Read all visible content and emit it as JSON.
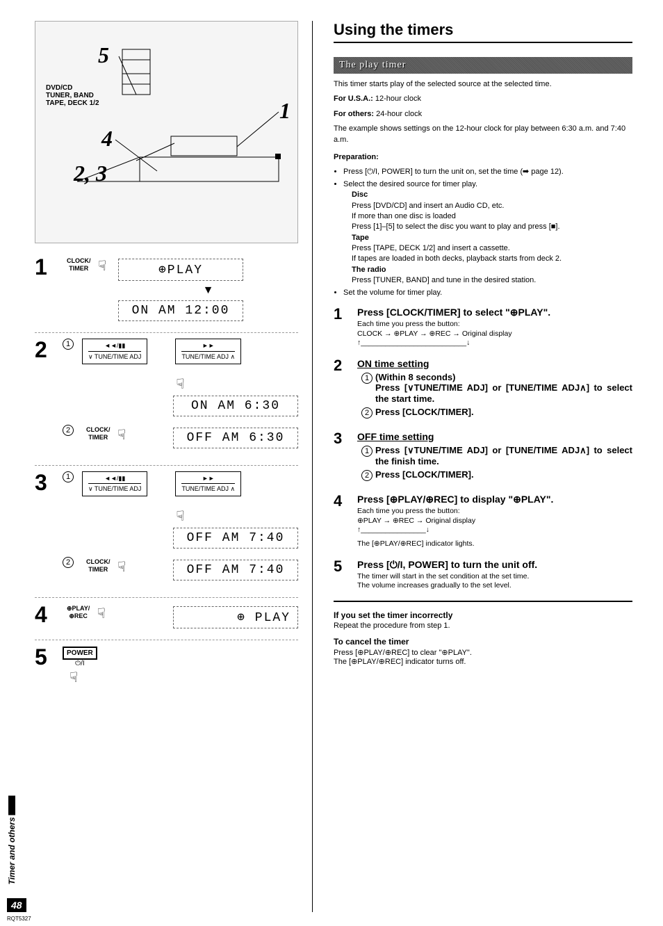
{
  "side_tab": "Timer and others",
  "page_number": "48",
  "doc_code": "RQT5327",
  "left": {
    "diag_labels": {
      "sources": "DVD/CD\nTUNER, BAND\nTAPE, DECK 1/2"
    },
    "diag_nums": {
      "n1": "1",
      "n2": "2, 3",
      "n4": "4",
      "n5": "5"
    },
    "step1": {
      "num": "1",
      "btn": "CLOCK/\nTIMER",
      "disp1": "⊕PLAY",
      "disp2": "ON   AM 12:00"
    },
    "step2": {
      "num": "2",
      "sub1": "①",
      "sub2": "②",
      "tune_left_top": "◄◄/▮▮",
      "tune_left_bot": "∨ TUNE/TIME ADJ",
      "tune_right_top": "►►",
      "tune_right_bot": "TUNE/TIME ADJ ∧",
      "btn": "CLOCK/\nTIMER",
      "disp1": "ON   AM  6:30",
      "disp2": "OFF  AM  6:30"
    },
    "step3": {
      "num": "3",
      "sub1": "①",
      "sub2": "②",
      "tune_left_top": "◄◄/▮▮",
      "tune_left_bot": "∨ TUNE/TIME ADJ",
      "tune_right_top": "►►",
      "tune_right_bot": "TUNE/TIME ADJ ∧",
      "btn": "CLOCK/\nTIMER",
      "disp1": "OFF  AM  7:40",
      "disp2": "OFF  AM  7:40"
    },
    "step4": {
      "num": "4",
      "btn": "⊕PLAY/\n⊕REC",
      "disp": "⊕ PLAY"
    },
    "step5": {
      "num": "5",
      "btn": "POWER",
      "btn_sub": "⏻/I"
    }
  },
  "right": {
    "title": "Using the timers",
    "banner": "The play timer",
    "intro": {
      "line1": "This timer starts play of the selected source at the selected time.",
      "usa_label": "For U.S.A.:",
      "usa_val": "12-hour clock",
      "others_label": "For others:",
      "others_val": "24-hour clock",
      "example": "The example shows settings on the 12-hour clock for play between 6:30 a.m. and 7:40 a.m."
    },
    "prep": {
      "header": "Preparation:",
      "b1": "Press [⏻/I, POWER] to turn the unit on, set the time (➡ page 12).",
      "b2": "Select the desired source for timer play.",
      "disc_hdr": "Disc",
      "disc1": "Press [DVD/CD] and insert an Audio CD, etc.",
      "disc2": "If more than one disc is loaded",
      "disc3": "Press [1]–[5] to select the disc you want to play and press [■].",
      "tape_hdr": "Tape",
      "tape1": "Press [TAPE, DECK 1/2] and insert a cassette.",
      "tape2": "If tapes are loaded in both decks, playback starts from deck 2.",
      "radio_hdr": "The radio",
      "radio1": "Press [TUNER, BAND] and tune in the desired station.",
      "b3": "Set the volume for timer play."
    },
    "steps": {
      "s1": {
        "hdr": "Press [CLOCK/TIMER] to select \"⊕PLAY\".",
        "sub1": "Each time you press the button:",
        "sub2": "CLOCK → ⊕PLAY → ⊕REC → Original display"
      },
      "s2": {
        "hdr": "ON time setting",
        "a": "(Within 8 seconds)\nPress [∨TUNE/TIME ADJ] or [TUNE/TIME ADJ∧] to select the start time.",
        "b": "Press [CLOCK/TIMER]."
      },
      "s3": {
        "hdr": "OFF time setting",
        "a": "Press [∨TUNE/TIME ADJ] or [TUNE/TIME ADJ∧] to select the finish time.",
        "b": "Press [CLOCK/TIMER]."
      },
      "s4": {
        "hdr": "Press [⊕PLAY/⊕REC] to display \"⊕PLAY\".",
        "sub1": "Each time you press the button:",
        "sub2": "⊕PLAY → ⊕REC → Original display",
        "sub3": "The [⊕PLAY/⊕REC] indicator lights."
      },
      "s5": {
        "hdr": "Press [⏻/I, POWER] to turn the unit off.",
        "sub1": "The timer will start in the set condition at the set time.",
        "sub2": "The volume increases gradually to the set level."
      }
    },
    "notes": {
      "n1_hdr": "If you set the timer incorrectly",
      "n1_body": "Repeat the procedure from step 1.",
      "n2_hdr": "To cancel the timer",
      "n2_body1": "Press [⊕PLAY/⊕REC] to clear \"⊕PLAY\".",
      "n2_body2": "The [⊕PLAY/⊕REC] indicator turns off."
    }
  }
}
